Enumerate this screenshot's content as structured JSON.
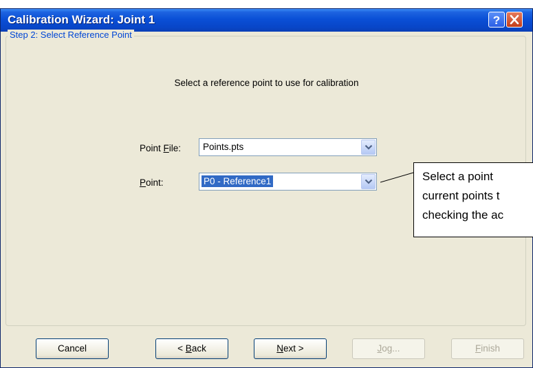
{
  "dialog": {
    "title": "Calibration Wizard: Joint 1",
    "help_icon": "help-icon",
    "close_icon": "close-icon"
  },
  "step": {
    "title": "Step 2: Select Reference Point",
    "instruction": "Select a reference point to use for calibration"
  },
  "point_file": {
    "label_pre": "Point ",
    "label_key": "F",
    "label_post": "ile:",
    "value": "Points.pts"
  },
  "point": {
    "label_key": "P",
    "label_post": "oint:",
    "value": "P0 - Reference1"
  },
  "callout": {
    "lines": [
      "Select a point",
      "current points t",
      "checking the ac"
    ]
  },
  "buttons": {
    "cancel": "Cancel",
    "back_pre": "< ",
    "back_key": "B",
    "back_post": "ack",
    "next_key": "N",
    "next_post": "ext >",
    "jog_key": "J",
    "jog_post": "og...",
    "finish_key": "F",
    "finish_post": "inish"
  },
  "colors": {
    "titlebar": "#0a4fd6",
    "group_title": "#0046d5",
    "selection": "#316ac5",
    "dialog_bg": "#ece9d8"
  }
}
